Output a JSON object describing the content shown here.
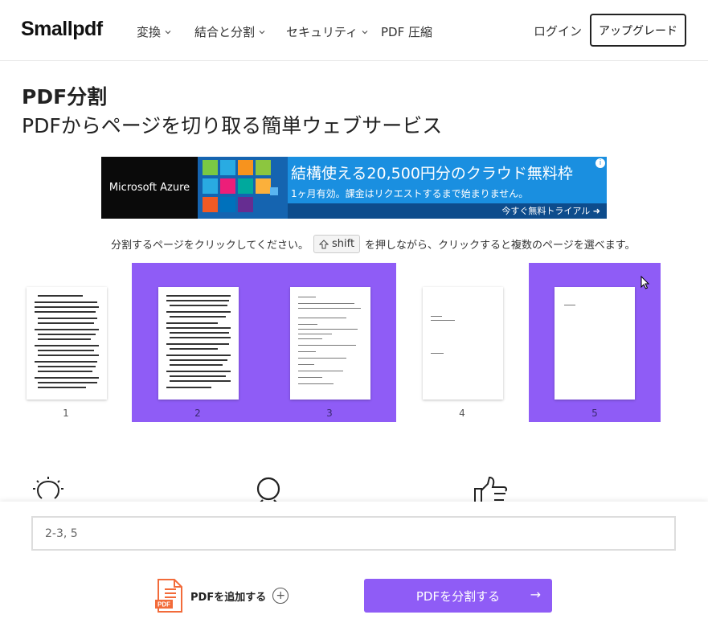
{
  "header": {
    "logo": "Smallpdf",
    "nav": [
      {
        "label": "変換"
      },
      {
        "label": "結合と分割"
      },
      {
        "label": "セキュリティ"
      },
      {
        "label": "PDF 圧縮"
      }
    ],
    "login": "ログイン",
    "upgrade": "アップグレード"
  },
  "main": {
    "title": "PDF分割",
    "subtitle": "PDFからページを切り取る簡単ウェブサービス"
  },
  "ad": {
    "brand": "Microsoft Azure",
    "headline": "結構使える20,500円分のクラウド無料枠",
    "subline": "1ヶ月有効。課金はリクエストするまで始まりません。",
    "cta": "今すぐ無料トライアル",
    "info": "i",
    "colors": {
      "bg": "#1a8fe0",
      "cta_bg": "#0d4c8c"
    }
  },
  "instruction": {
    "before": "分割するページをクリックしてください。",
    "key": "shift",
    "after": "を押しながら、クリックすると複数のページを選べます。"
  },
  "pages": [
    {
      "num": "1",
      "selected": false
    },
    {
      "num": "2",
      "selected": true
    },
    {
      "num": "3",
      "selected": true
    },
    {
      "num": "4",
      "selected": false
    },
    {
      "num": "5",
      "selected": true
    }
  ],
  "colors": {
    "accent": "#8f5cf6"
  },
  "bottom": {
    "range_value": "2-3, 5",
    "add_pdf_label": "PDFを追加する",
    "split_label": "PDFを分割する",
    "pdf_badge": "PDF"
  }
}
